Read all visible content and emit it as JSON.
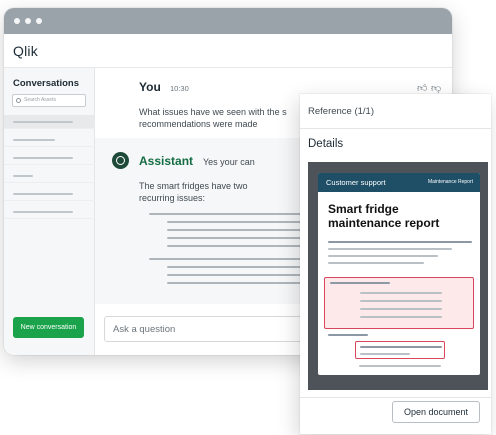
{
  "app": {
    "logo": "Qlik"
  },
  "sidebar": {
    "title": "Conversations",
    "search_placeholder": "Search Assets",
    "new_conversation_label": "New conversation"
  },
  "chat": {
    "user": {
      "name": "You",
      "time": "10:30",
      "message": "What issues have we seen with the s recommendations were made"
    },
    "assistant": {
      "name": "Assistant",
      "tagline": "Yes your can",
      "message": "The smart fridges have two recurring issues:"
    },
    "ask_placeholder": "Ask a question"
  },
  "reference": {
    "title": "Reference (1/1)",
    "details_label": "Details",
    "document": {
      "header_left": "Customer support",
      "header_right": "Maintenance Report",
      "title": "Smart fridge maintenance report"
    },
    "open_label": "Open document"
  },
  "colors": {
    "brand_green": "#1aa34a",
    "assistant_green": "#146c43",
    "doc_header": "#1e4f66",
    "highlight_red": "#d9465b"
  }
}
